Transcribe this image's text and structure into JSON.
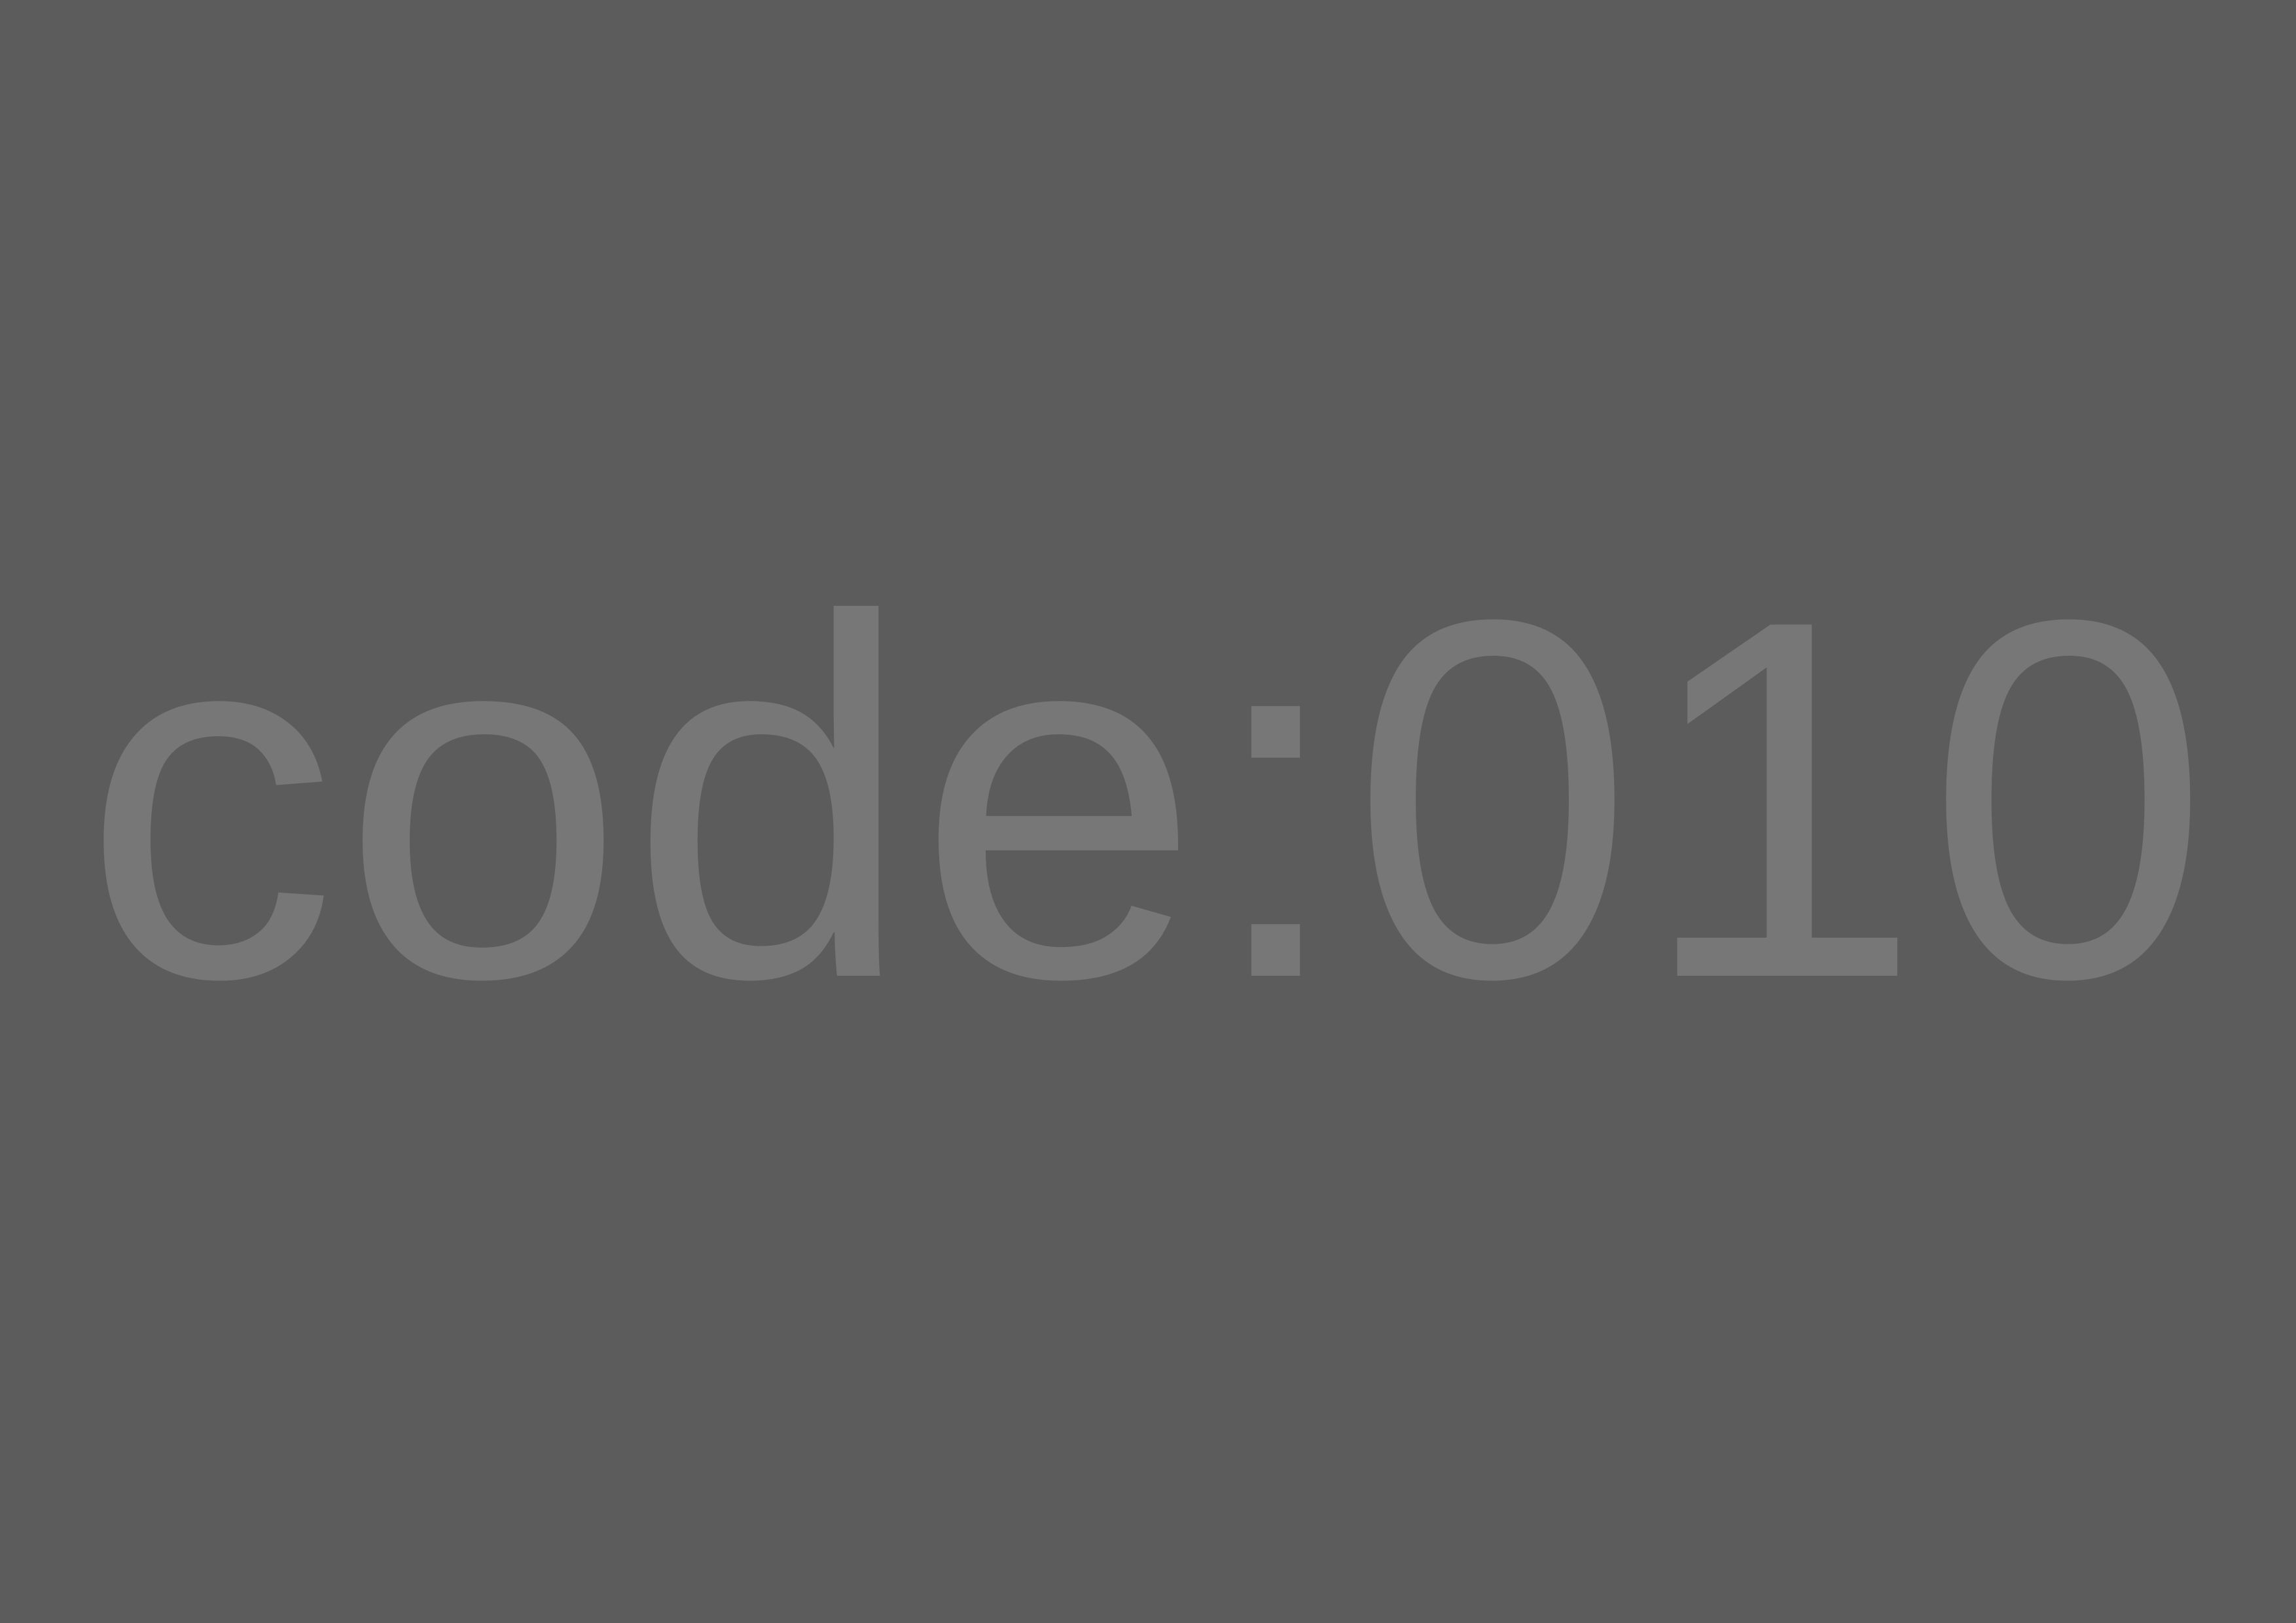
{
  "screen": {
    "background_color": "#5c5c5c",
    "text_color": "#777777",
    "code_text": "code:010"
  }
}
